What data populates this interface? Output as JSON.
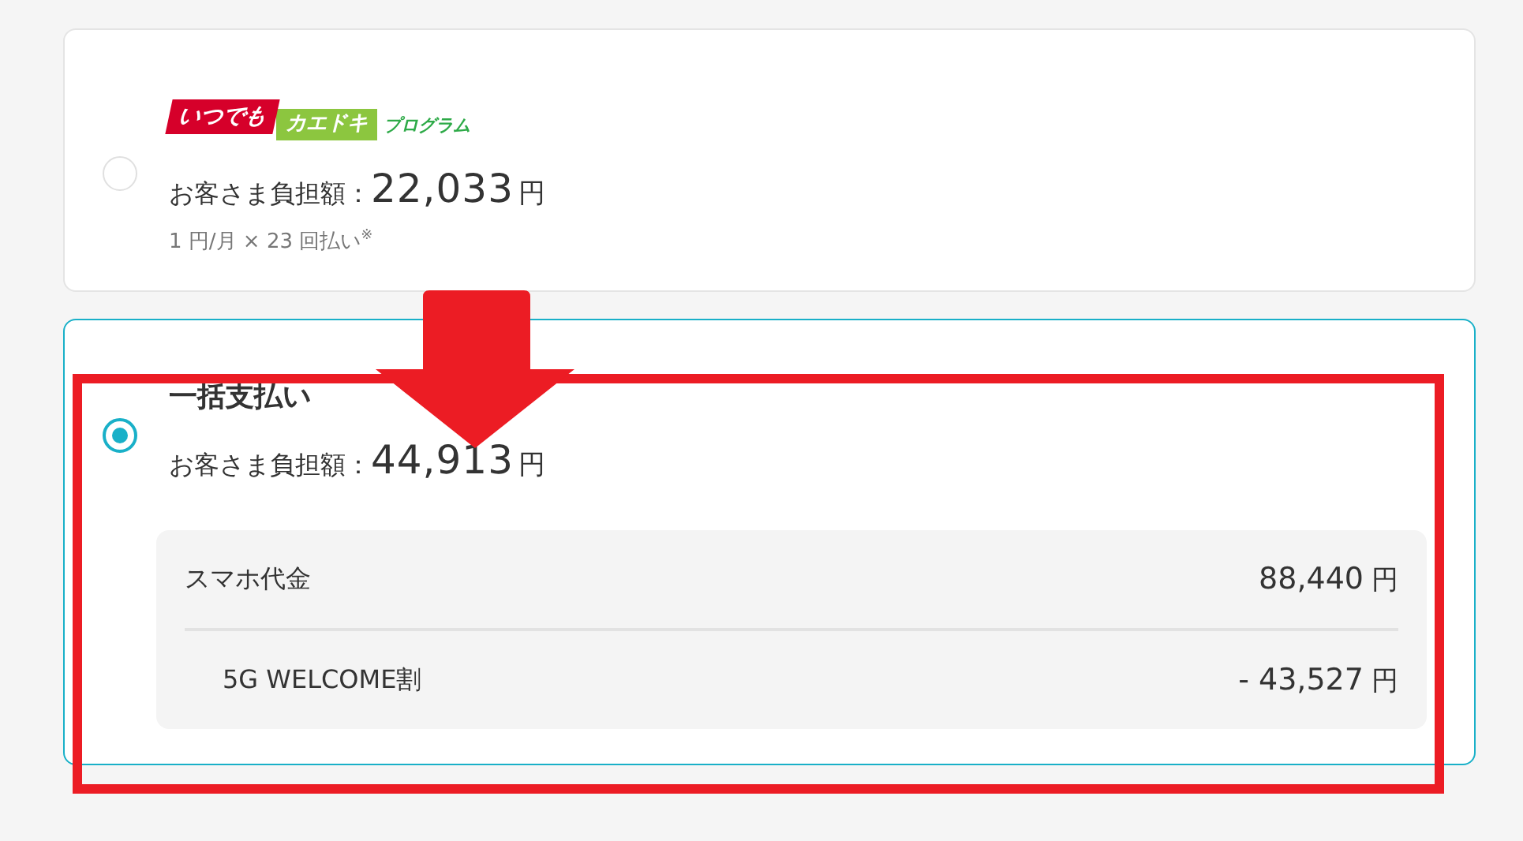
{
  "plans": [
    {
      "kind": "logo",
      "selected": false,
      "logo": [
        "いつでも",
        "カエドキ",
        "プログラム"
      ],
      "amount_label": "お客さま負担額：",
      "amount": "22,033",
      "unit": "円",
      "note": "1 円/月 × 23 回払い",
      "note_mark": "※"
    },
    {
      "kind": "title",
      "selected": true,
      "title": "一括支払い",
      "amount_label": "お客さま負担額：",
      "amount": "44,913",
      "unit": "円",
      "breakdown": [
        {
          "kind": "item",
          "label": "スマホ代金",
          "value": "88,440",
          "unit": "円"
        },
        {
          "kind": "discount",
          "label": "5G WELCOME割",
          "value": "- 43,527",
          "unit": "円"
        }
      ]
    }
  ]
}
